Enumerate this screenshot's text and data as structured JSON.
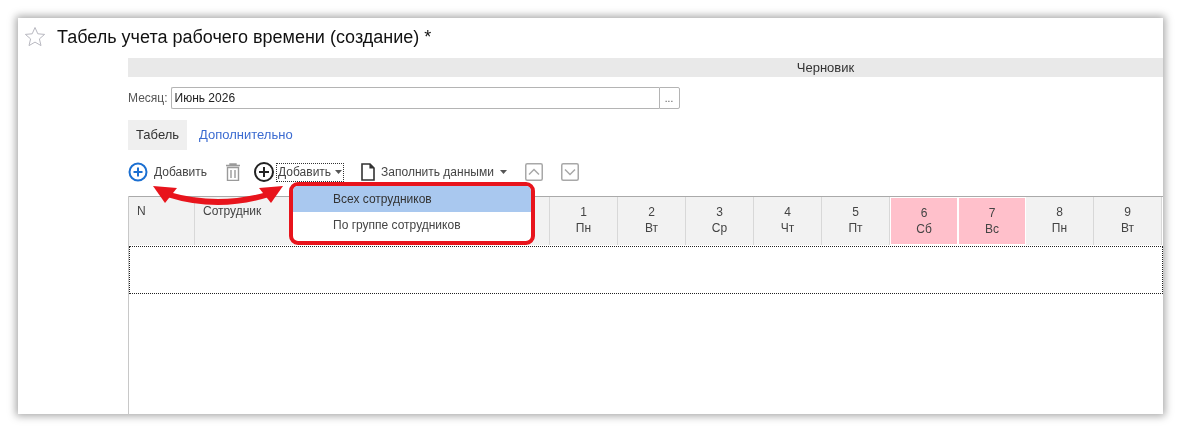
{
  "window": {
    "title": "Табель учета рабочего времени (создание) *",
    "favorite": false
  },
  "status": "Черновик",
  "month": {
    "label": "Месяц:",
    "value": "Июнь 2026",
    "button": "..."
  },
  "tabs": [
    {
      "label": "Табель",
      "selected": true
    },
    {
      "label": "Дополнительно",
      "selected": false
    }
  ],
  "toolbar": [
    {
      "kind": "add",
      "label": "Добавить"
    },
    {
      "kind": "delete"
    },
    {
      "kind": "add-menu",
      "label": "Добавить",
      "open": true
    },
    {
      "kind": "fill",
      "label": "Заполнить данными"
    },
    {
      "kind": "up"
    },
    {
      "kind": "down"
    }
  ],
  "dropdown": {
    "items": [
      {
        "label": "Всех сотрудников",
        "selected": true
      },
      {
        "label": "По группе сотрудников",
        "selected": false
      }
    ]
  },
  "table": {
    "columns": [
      "N",
      "Сотрудник"
    ],
    "days": [
      {
        "day": "1",
        "weekday": "Пн",
        "weekend": false
      },
      {
        "day": "2",
        "weekday": "Вт",
        "weekend": false
      },
      {
        "day": "3",
        "weekday": "Ср",
        "weekend": false
      },
      {
        "day": "4",
        "weekday": "Чт",
        "weekend": false
      },
      {
        "day": "5",
        "weekday": "Пт",
        "weekend": false
      },
      {
        "day": "6",
        "weekday": "Сб",
        "weekend": true
      },
      {
        "day": "7",
        "weekday": "Вс",
        "weekend": true
      },
      {
        "day": "8",
        "weekday": "Пн",
        "weekend": false
      },
      {
        "day": "9",
        "weekday": "Вт",
        "weekend": false
      }
    ]
  }
}
